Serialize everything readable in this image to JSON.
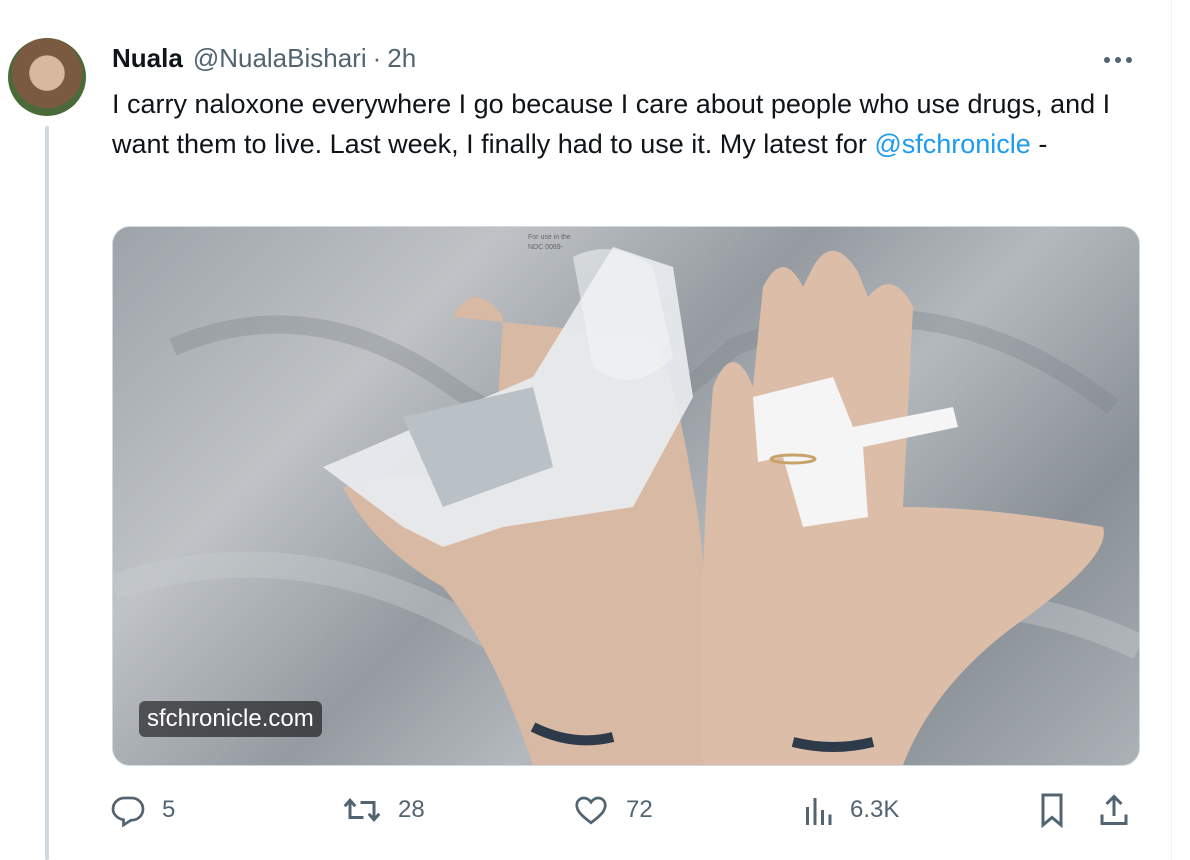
{
  "tweet": {
    "author_name": "Nuala",
    "handle": "@NualaBishari",
    "separator": "·",
    "time": "2h",
    "text_before": "I carry naloxone everywhere I go because I care about people who use drugs, and I want them to live. Last week, I finally had to use it. My latest for ",
    "mention": "@sfchronicle",
    "text_after": "  -"
  },
  "media": {
    "caption": "sfchronicle.com",
    "packaging_text_1": "For use in the",
    "packaging_text_2": "NDC 0069-"
  },
  "actions": {
    "replies": "5",
    "retweets": "28",
    "likes": "72",
    "views": "6.3K"
  },
  "colors": {
    "accent": "#1d9bf0",
    "secondary_text": "#536471",
    "primary_text": "#0f1419"
  },
  "icons": [
    "more-icon",
    "reply-icon",
    "retweet-icon",
    "like-icon",
    "views-icon",
    "bookmark-icon",
    "share-icon"
  ]
}
